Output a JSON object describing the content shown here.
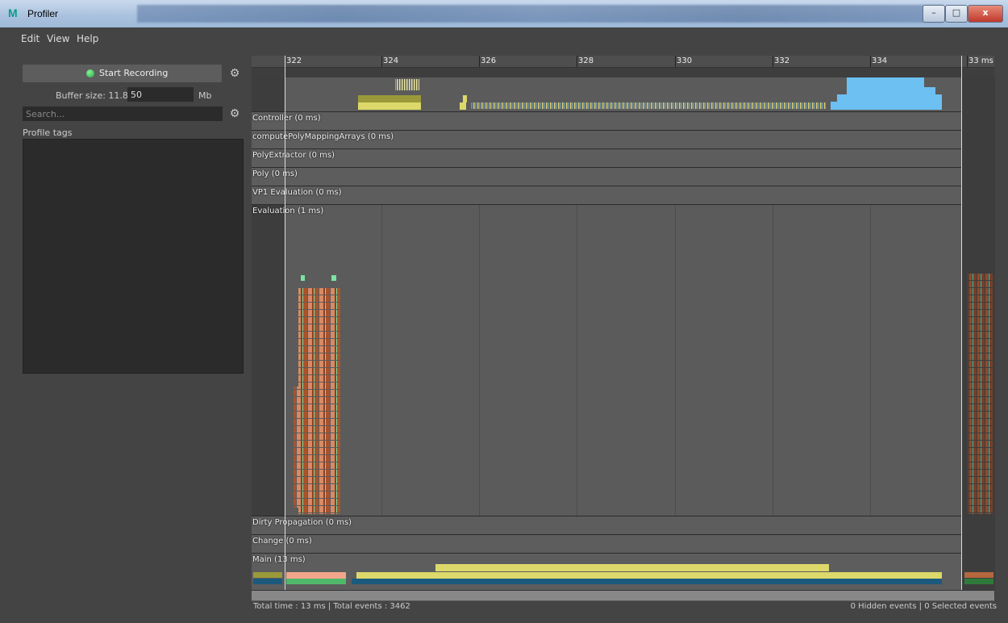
{
  "window": {
    "title": "Profiler",
    "logo": "M"
  },
  "menu": {
    "items": [
      "Edit",
      "View",
      "Help"
    ]
  },
  "left_panel": {
    "record_label": "Start Recording",
    "buffer_label": "Buffer size: 11.8 /",
    "buffer_value": "50",
    "buffer_unit": "Mb",
    "search_placeholder": "Search...",
    "tags_label": "Profile tags"
  },
  "timeline": {
    "ticks": [
      "322",
      "324",
      "326",
      "328",
      "330",
      "332",
      "334",
      "33 ms"
    ],
    "lanes": [
      "Controller (0 ms)",
      "computePolyMappingArrays (0 ms)",
      "PolyExtractor (0 ms)",
      "Poly (0 ms)",
      "VP1 Evaluation (0 ms)",
      "Evaluation (1 ms)",
      "Dirty Propagation (0 ms)",
      "Change (0 ms)",
      "Main (13 ms)"
    ]
  },
  "status": {
    "left": "Total time : 13 ms | Total events : 3462",
    "right": "0 Hidden events | 0 Selected events"
  },
  "colors": {
    "background": "#444444",
    "lane": "#5d5d5d",
    "event_blue": "#6cc0f2",
    "event_yellow": "#dcd86a",
    "event_olive": "#9a9a3a",
    "event_salmon": "#d78a66",
    "event_brown": "#8a3f22",
    "event_green": "#7ae3a0",
    "main_teal": "#1c5a7d"
  }
}
